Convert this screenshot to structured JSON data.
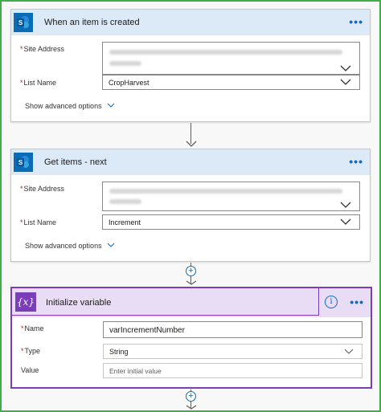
{
  "trigger": {
    "title": "When an item is created",
    "more_label": "•••",
    "site_address_label": "Site Address",
    "list_name_label": "List Name",
    "list_name_value": "CropHarvest",
    "advanced_label": "Show advanced options",
    "required_mark": "*"
  },
  "get_items": {
    "title": "Get items - next",
    "more_label": "•••",
    "site_address_label": "Site Address",
    "list_name_label": "List Name",
    "list_name_value": "Increment",
    "advanced_label": "Show advanced options",
    "required_mark": "*"
  },
  "init_variable": {
    "icon_text": "{x}",
    "title": "Initialize variable",
    "info_label": "i",
    "more_label": "•••",
    "name_label": "Name",
    "name_value": "varIncrementNumber",
    "type_label": "Type",
    "type_value": "String",
    "value_label": "Value",
    "value_placeholder": "Enter initial value",
    "required_mark": "*"
  },
  "add_step_label": "+",
  "colors": {
    "frame_border": "#3fae49",
    "sharepoint_blue": "#0b6cb6",
    "connector_header": "#dce9f7",
    "variable_purple": "#7a3fb8",
    "variable_header": "#e9dcf5",
    "link_blue": "#0f6cbd"
  },
  "icons": [
    "sharepoint-icon",
    "variable-icon",
    "info-icon",
    "chevron-down-icon",
    "more-options-icon",
    "add-step-icon",
    "arrow-down-icon"
  ]
}
